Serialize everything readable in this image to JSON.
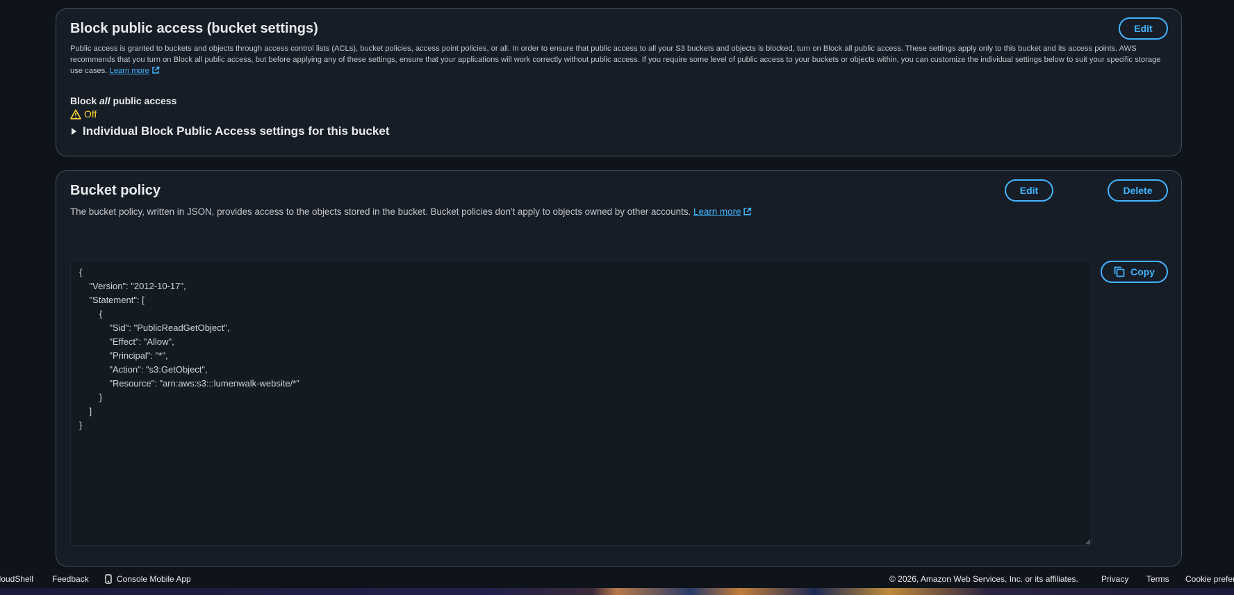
{
  "block_public_access": {
    "title": "Block public access (bucket settings)",
    "edit_label": "Edit",
    "description": "Public access is granted to buckets and objects through access control lists (ACLs), bucket policies, access point policies, or all. In order to ensure that public access to all your S3 buckets and objects is blocked, turn on Block all public access. These settings apply only to this bucket and its access points. AWS recommends that you turn on Block all public access, but before applying any of these settings, ensure that your applications will work correctly without public access. If you require some level of public access to your buckets or objects within, you can customize the individual settings below to suit your specific storage use cases.",
    "learn_more": "Learn more",
    "label_prefix": "Block ",
    "label_emphasis": "all",
    "label_suffix": " public access",
    "status": "Off",
    "status_color": "#fbd332",
    "expander_label": "Individual Block Public Access settings for this bucket",
    "status_icon": "warning-icon"
  },
  "bucket_policy": {
    "title": "Bucket policy",
    "edit_label": "Edit",
    "delete_label": "Delete",
    "description": "The bucket policy, written in JSON, provides access to the objects stored in the bucket. Bucket policies don't apply to objects owned by other accounts.",
    "learn_more": "Learn more",
    "copy_label": "Copy",
    "policy_json": "{\n    \"Version\": \"2012-10-17\",\n    \"Statement\": [\n        {\n            \"Sid\": \"PublicReadGetObject\",\n            \"Effect\": \"Allow\",\n            \"Principal\": \"*\",\n            \"Action\": \"s3:GetObject\",\n            \"Resource\": \"arn:aws:s3:::lumenwalk-website/*\"\n        }\n    ]\n}"
  },
  "footer": {
    "cloudshell": "CloudShell",
    "feedback": "Feedback",
    "mobile_app": "Console Mobile App",
    "copyright": "© 2026, Amazon Web Services, Inc. or its affiliates.",
    "privacy": "Privacy",
    "terms": "Terms",
    "cookie": "Cookie preferences"
  },
  "colors": {
    "accent": "#42b4ff",
    "warning": "#fbd332",
    "background": "#0f141a",
    "panel": "#161d26"
  }
}
